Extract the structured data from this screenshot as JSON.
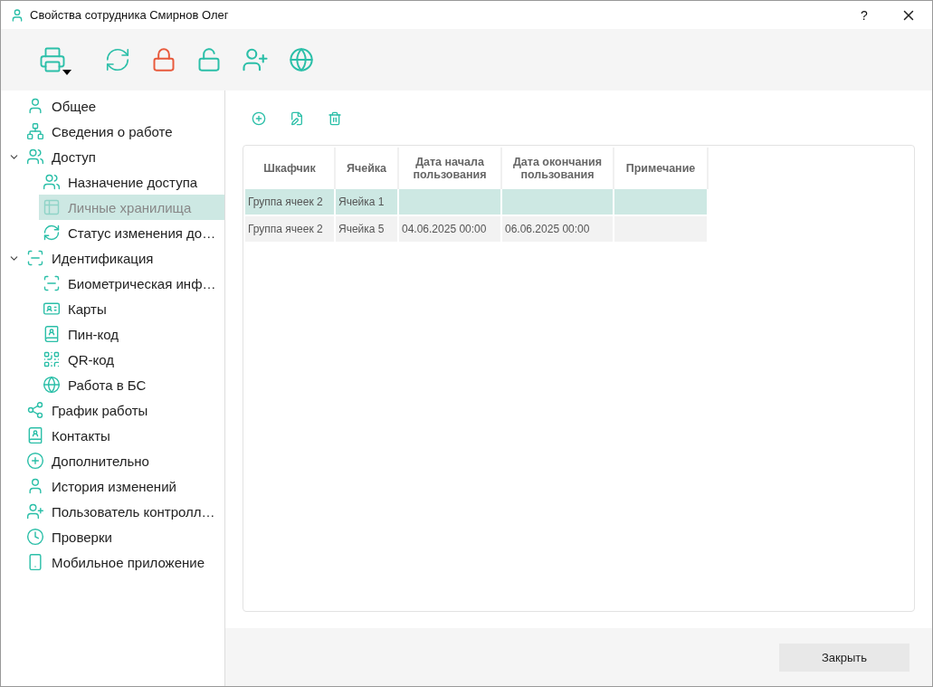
{
  "window": {
    "title": "Свойства сотрудника Смирнов Олег",
    "help": "?"
  },
  "sidebar": {
    "items": [
      {
        "label": "Общее",
        "selected": false
      },
      {
        "label": "Сведения о работе",
        "selected": false
      },
      {
        "label": "Доступ",
        "selected": false,
        "expanded": true,
        "children": [
          {
            "label": "Назначение доступа",
            "selected": false
          },
          {
            "label": "Личные хранилища",
            "selected": true
          },
          {
            "label": "Статус изменения до…",
            "selected": false
          }
        ]
      },
      {
        "label": "Идентификация",
        "selected": false,
        "expanded": true,
        "children": [
          {
            "label": "Биометрическая инф…",
            "selected": false
          },
          {
            "label": "Карты",
            "selected": false
          },
          {
            "label": "Пин-код",
            "selected": false
          },
          {
            "label": "QR-код",
            "selected": false
          },
          {
            "label": "Работа в БС",
            "selected": false
          }
        ]
      },
      {
        "label": "График работы",
        "selected": false
      },
      {
        "label": "Контакты",
        "selected": false
      },
      {
        "label": "Дополнительно",
        "selected": false
      },
      {
        "label": "История изменений",
        "selected": false
      },
      {
        "label": "Пользователь контролл…",
        "selected": false
      },
      {
        "label": "Проверки",
        "selected": false
      },
      {
        "label": "Мобильное приложение",
        "selected": false
      }
    ]
  },
  "table": {
    "columns": [
      "Шкафчик",
      "Ячейка",
      "Дата начала пользования",
      "Дата окончания пользования",
      "Примечание"
    ],
    "rows": [
      {
        "selected": true,
        "cells": [
          "Группа ячеек 2",
          "Ячейка 1",
          "",
          "",
          ""
        ]
      },
      {
        "selected": false,
        "cells": [
          "Группа ячеек 2",
          "Ячейка 5",
          "04.06.2025 00:00",
          "06.06.2025 00:00",
          ""
        ]
      }
    ]
  },
  "footer": {
    "close_button": "Закрыть"
  }
}
